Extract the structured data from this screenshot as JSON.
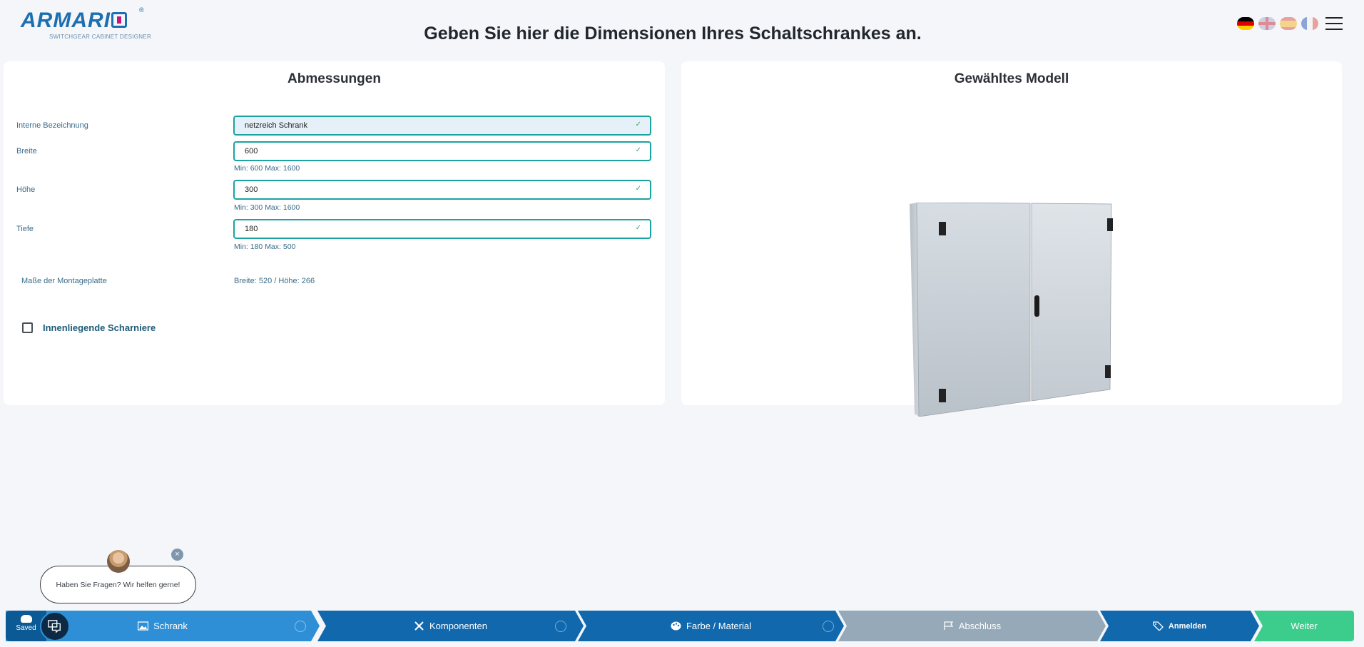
{
  "header": {
    "logo_text": "ARMARIO",
    "logo_tagline": "SWITCHGEAR CABINET DESIGNER",
    "logo_reg": "®",
    "title": "Geben Sie hier die Dimensionen Ihres Schaltschrankes an."
  },
  "languages": [
    "de",
    "gb",
    "es",
    "fr"
  ],
  "left_panel": {
    "title": "Abmessungen",
    "fields": [
      {
        "label": "Interne Bezeichnung",
        "value": "netzreich Schrank",
        "hint": ""
      },
      {
        "label": "Breite",
        "value": "600",
        "hint": "Min: 600 Max: 1600"
      },
      {
        "label": "Höhe",
        "value": "300",
        "hint": "Min: 300 Max: 1600"
      },
      {
        "label": "Tiefe",
        "value": "180",
        "hint": "Min: 180 Max: 500"
      }
    ],
    "mounting_plate": {
      "label": "Maße der Montageplatte",
      "value": "Breite: 520 / Höhe: 266"
    },
    "checkbox": {
      "label": "Innenliegende Scharniere",
      "checked": false
    }
  },
  "right_panel": {
    "title": "Gewähltes Modell"
  },
  "chat": {
    "message": "Haben Sie Fragen? Wir helfen gerne!",
    "close": "×"
  },
  "bottom": {
    "saved": "Saved",
    "steps": [
      {
        "label": "Schrank",
        "icon": "image-icon"
      },
      {
        "label": "Komponenten",
        "icon": "tools-icon"
      },
      {
        "label": "Farbe / Material",
        "icon": "palette-icon"
      },
      {
        "label": "Abschluss",
        "icon": "flag-icon"
      },
      {
        "label": "Anmelden",
        "icon": "tag-icon"
      },
      {
        "label": "Weiter",
        "icon": ""
      }
    ]
  },
  "colors": {
    "accent_teal": "#1aa3a0",
    "step_active": "#2f8fd6",
    "step_dark": "#1168ad",
    "step_disabled": "#95a9b8",
    "next_green": "#3ccc8c"
  }
}
